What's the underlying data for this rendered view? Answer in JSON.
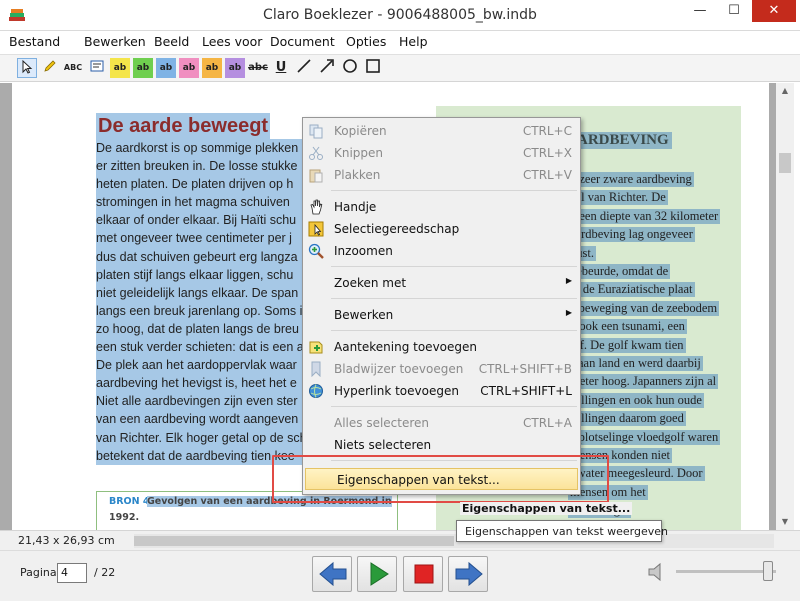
{
  "window": {
    "title": "Claro Boeklezer - 9006488005_bw.indb",
    "minimize": "—",
    "maximize": "☐",
    "close": "✕"
  },
  "menubar": {
    "items": [
      "Bestand",
      "Bewerken",
      "Beeld",
      "Lees voor",
      "Document",
      "Opties",
      "Help"
    ]
  },
  "toolbar": {
    "abc_label": "ABC",
    "ab_label": "ab",
    "strike_label": "abc",
    "underline_label": "U"
  },
  "document": {
    "heading": "De aarde beweegt",
    "body_lines": [
      "De aardkorst is op sommige plekken",
      "er zitten breuken in. De losse stukke",
      "heten platen. De platen drijven op h",
      "stromingen in het magma schuiven",
      "elkaar of onder elkaar. Bij Haïti schu",
      "met ongeveer twee centimeter per j",
      "dus dat schuiven gebeurt erg langza",
      "platen stijf langs elkaar liggen, schu",
      "niet geleidelijk langs elkaar. De span",
      "langs een breuk jarenlang op. Soms i",
      "zo hoog, dat de platen langs de breu",
      "een stuk verder schieten: dat is een a",
      "De plek aan het aardoppervlak waar",
      "aardbeving het hevigst is, heet het e",
      "Niet alle aardbevingen zijn even ster",
      "van een aardbeving wordt aangeven",
      "van Richter. Elk hoger getal op de sch",
      "betekent dat de aardbeving tien kee"
    ],
    "sidebar_title": "ARDBEVING",
    "sidebar_lines": [
      "n zeer zware aardbeving",
      "aal van Richter. De",
      "p een diepte van 32 kilometer",
      "aardbeving lag ongeveer",
      "kust.",
      "gebeurde, omdat de",
      "er de Euraziatische plaat",
      "e beweging van de zeebodem",
      "n ook een tsunami, een",
      "olf. De golf kwam tien",
      "s aan land en werd daarbij",
      "meter hoog. Japanners zijn al",
      "trillingen en ook hun oude",
      "trillingen daarom goed",
      "e plotselinge vloedgolf waren",
      "mensen konden niet",
      "t water meegesleurd. Door",
      "mensen om het",
      "beschadigd."
    ],
    "bron_label": "BRON 4",
    "bron_text": "Gevolgen van een aardbeving in Roermond in",
    "bron_year": "1992."
  },
  "status": {
    "dimensions": "21,43 x 26,93 cm"
  },
  "navigation": {
    "page_label": "Pagina",
    "page_value": "4",
    "page_total": "/ 22"
  },
  "context_menu": {
    "items": [
      {
        "label": "Kopiëren",
        "shortcut": "CTRL+C",
        "enabled": false
      },
      {
        "label": "Knippen",
        "shortcut": "CTRL+X",
        "enabled": false
      },
      {
        "label": "Plakken",
        "shortcut": "CTRL+V",
        "enabled": false
      },
      {
        "label": "Handje",
        "shortcut": "",
        "enabled": true
      },
      {
        "label": "Selectiegereedschap",
        "shortcut": "",
        "enabled": true
      },
      {
        "label": "Inzoomen",
        "shortcut": "",
        "enabled": true
      },
      {
        "label": "Zoeken met",
        "shortcut": "",
        "enabled": true
      },
      {
        "label": "Bewerken",
        "shortcut": "",
        "enabled": true
      },
      {
        "label": "Aantekening toevoegen",
        "shortcut": "",
        "enabled": true
      },
      {
        "label": "Bladwijzer toevoegen",
        "shortcut": "CTRL+SHIFT+B",
        "enabled": false
      },
      {
        "label": "Hyperlink toevoegen",
        "shortcut": "CTRL+SHIFT+L",
        "enabled": true
      },
      {
        "label": "Alles selecteren",
        "shortcut": "CTRL+A",
        "enabled": false
      },
      {
        "label": "Niets selecteren",
        "shortcut": "",
        "enabled": true
      },
      {
        "label": "Eigenschappen van tekst...",
        "shortcut": "",
        "enabled": true
      }
    ]
  },
  "tooltip": {
    "title": "Eigenschappen van tekst...",
    "text": "Eigenschappen van tekst weergeven"
  },
  "colors": {
    "selection": "#a6c8e6",
    "heading": "#8b2c2c",
    "sidebar_bg": "#d9ead0",
    "highlight_box": "#e14b45",
    "play": "#2a9a3a",
    "stop": "#e02424",
    "nav_arrow": "#3f74c4"
  }
}
